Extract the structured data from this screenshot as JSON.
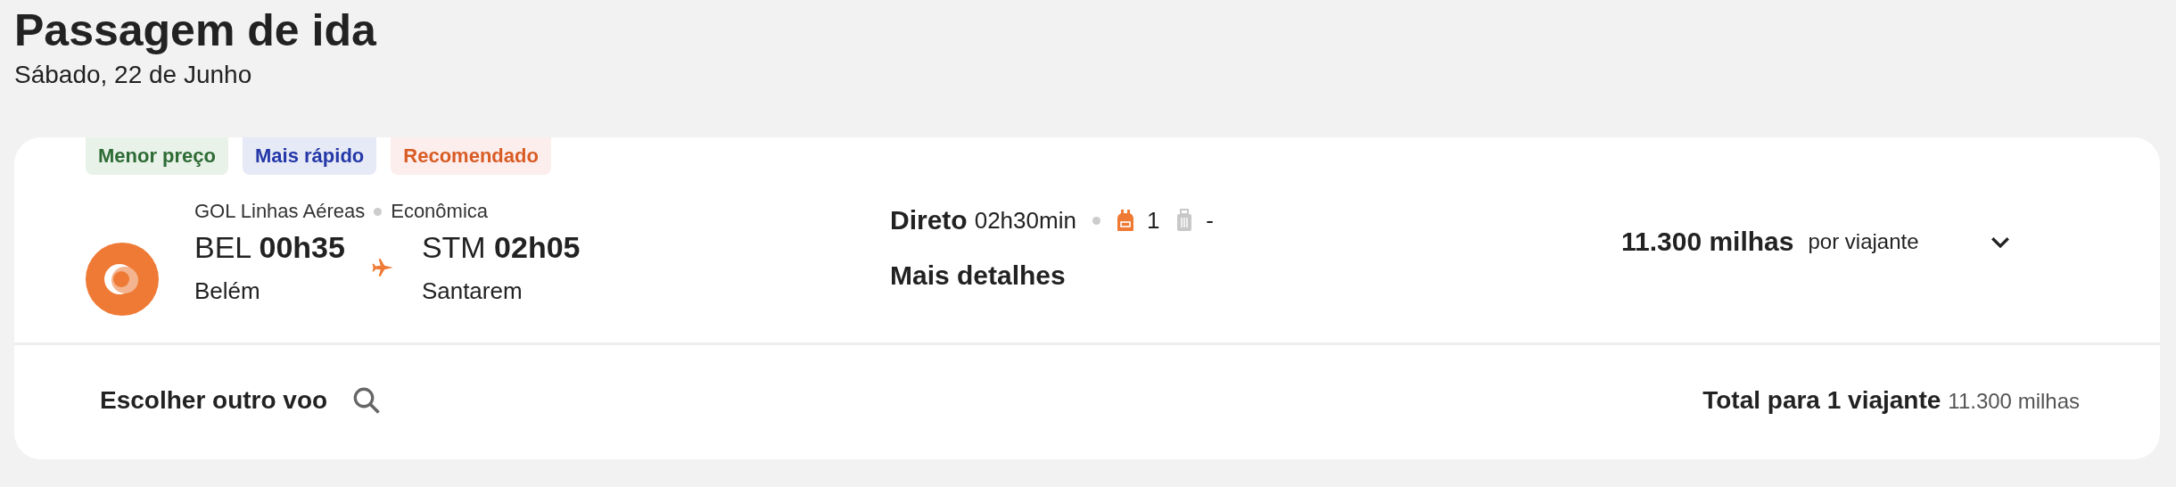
{
  "header": {
    "title": "Passagem de ida",
    "date": "Sábado, 22 de Junho"
  },
  "tags": [
    {
      "label": "Menor preço",
      "color": "#2e6b34"
    },
    {
      "label": "Mais rápido",
      "color": "#2438a8"
    },
    {
      "label": "Recomendado",
      "color": "#d85c24"
    }
  ],
  "flight": {
    "airline": "GOL Linhas Aéreas",
    "cabin": "Econômica",
    "origin": {
      "code": "BEL",
      "time": "00h35",
      "city": "Belém"
    },
    "destination": {
      "code": "STM",
      "time": "02h05",
      "city": "Santarem"
    },
    "stops": "Direto",
    "duration": "02h30min",
    "baggage": [
      {
        "kind": "backpack",
        "included": true,
        "count": "1"
      },
      {
        "kind": "suitcase",
        "included": false,
        "count": "-"
      }
    ],
    "details_link": "Mais detalhes",
    "price": "11.300 milhas",
    "price_note": "por viajante",
    "expanded": false
  },
  "footer": {
    "choose_other": "Escolher outro voo",
    "total_label": "Total para 1 viajante",
    "total_value": "11.300 milhas"
  }
}
